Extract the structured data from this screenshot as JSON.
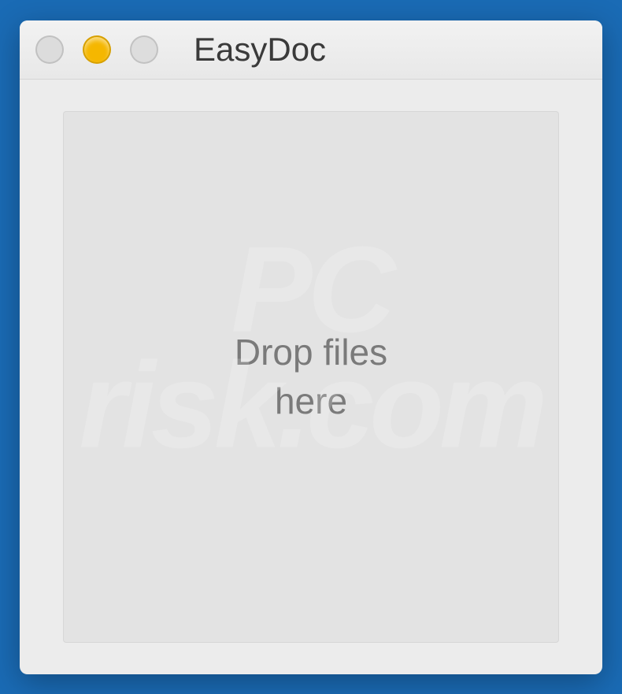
{
  "window": {
    "title": "EasyDoc"
  },
  "dropzone": {
    "text": "Drop files\nhere"
  },
  "watermark": {
    "text": "PC\nrisk.com"
  }
}
